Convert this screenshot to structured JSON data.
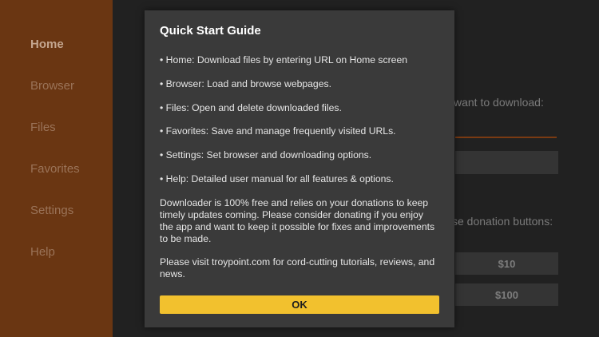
{
  "sidebar": {
    "items": [
      {
        "label": "Home",
        "active": true
      },
      {
        "label": "Browser"
      },
      {
        "label": "Files"
      },
      {
        "label": "Favorites"
      },
      {
        "label": "Settings"
      },
      {
        "label": "Help"
      }
    ]
  },
  "background": {
    "url_prompt": "want to download:",
    "donation_prompt": "se donation buttons:",
    "donation_buttons": [
      "$10",
      "$100"
    ]
  },
  "dialog": {
    "title": "Quick Start Guide",
    "bullets": [
      "• Home: Download files by entering URL on Home screen",
      "• Browser: Load and browse webpages.",
      "• Files: Open and delete downloaded files.",
      "• Favorites: Save and manage frequently visited URLs.",
      "• Settings: Set browser and downloading options.",
      "• Help: Detailed user manual for all features & options."
    ],
    "donation_text": "Downloader is 100% free and relies on your donations to keep timely updates coming. Please consider donating if you enjoy the app and want to keep it possible for fixes and improvements to be made.",
    "visit_text": "Please visit troypoint.com for cord-cutting tutorials, reviews, and news.",
    "ok_label": "OK"
  },
  "colors": {
    "sidebar_bg": "#6a3612",
    "dialog_bg": "#3a3a3a",
    "accent_button": "#f2c12e"
  }
}
